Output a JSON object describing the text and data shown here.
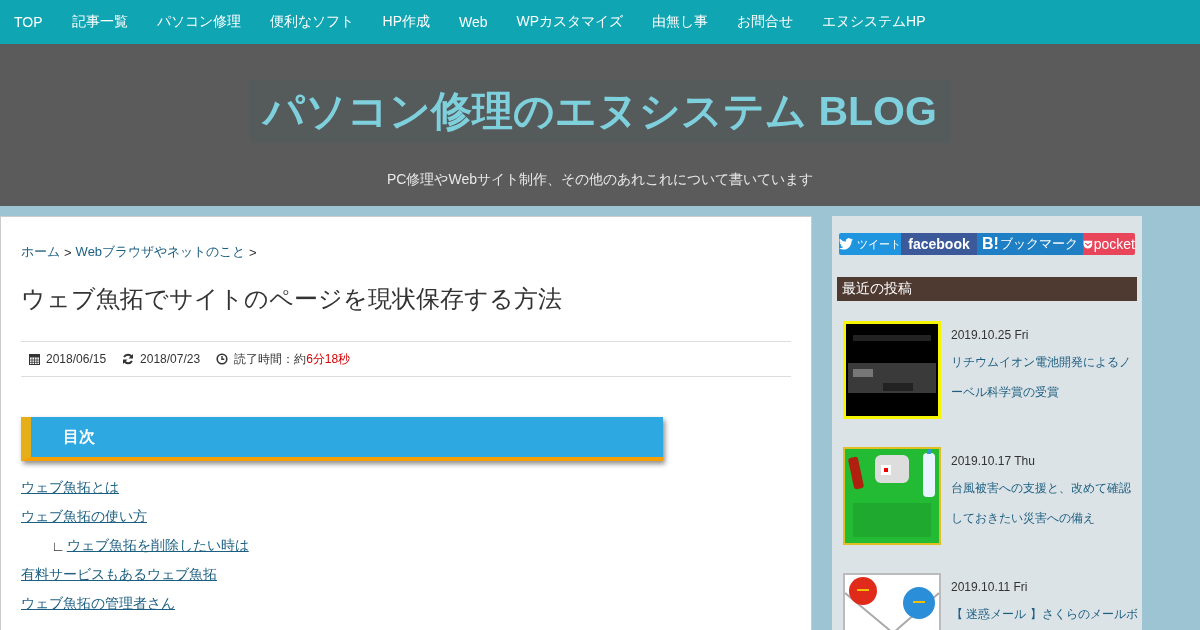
{
  "nav": {
    "items": [
      {
        "label": "TOP"
      },
      {
        "label": "記事一覧"
      },
      {
        "label": "パソコン修理"
      },
      {
        "label": "便利なソフト"
      },
      {
        "label": "HP作成"
      },
      {
        "label": "Web"
      },
      {
        "label": "WPカスタマイズ"
      },
      {
        "label": "由無し事"
      },
      {
        "label": "お問合せ"
      },
      {
        "label": "エヌシステムHP"
      }
    ]
  },
  "header": {
    "title": "パソコン修理のエヌシステム BLOG",
    "tagline": "PC修理やWebサイト制作、その他のあれこれについて書いています"
  },
  "article": {
    "breadcrumbs": [
      {
        "label": "ホーム",
        "separator": ">"
      },
      {
        "label": "Webブラウザやネットのこと",
        "separator": ">"
      }
    ],
    "title": "ウェブ魚拓でサイトのページを現状保存する方法",
    "meta": {
      "published": "2018/06/15",
      "updated": "2018/07/23",
      "reading_label": "読了時間：約",
      "reading_value": "6分18秒"
    },
    "toc": {
      "heading": "目次",
      "items": [
        {
          "label": "ウェブ魚拓とは"
        },
        {
          "label": "ウェブ魚拓の使い方",
          "children": [
            {
              "label": "ウェブ魚拓を削除したい時は",
              "marker": "∟"
            }
          ]
        },
        {
          "label": "有料サービスもあるウェブ魚拓"
        },
        {
          "label": "ウェブ魚拓の管理者さん"
        }
      ]
    }
  },
  "sidebar": {
    "share": [
      {
        "kind": "twitter",
        "label": "ツイート"
      },
      {
        "kind": "facebook",
        "label": "facebook"
      },
      {
        "kind": "hatena",
        "logo": "B!",
        "label": "ブックマーク"
      },
      {
        "kind": "pocket",
        "label": "pocket"
      }
    ],
    "recent_heading": "最近の投稿",
    "posts": [
      {
        "date": "2019.10.25 Fri",
        "title": "リチウムイオン電池開発によるノーベル科学賞の受賞",
        "kind": "picture"
      },
      {
        "date": "2019.10.17 Thu",
        "title": "台風被害への支援と、改めて確認しておきたい災害への備え",
        "kind": "picture"
      },
      {
        "date": "2019.10.11 Fri",
        "title": "【 迷惑メール 】さくらのメールボ",
        "kind": "picture"
      }
    ]
  }
}
